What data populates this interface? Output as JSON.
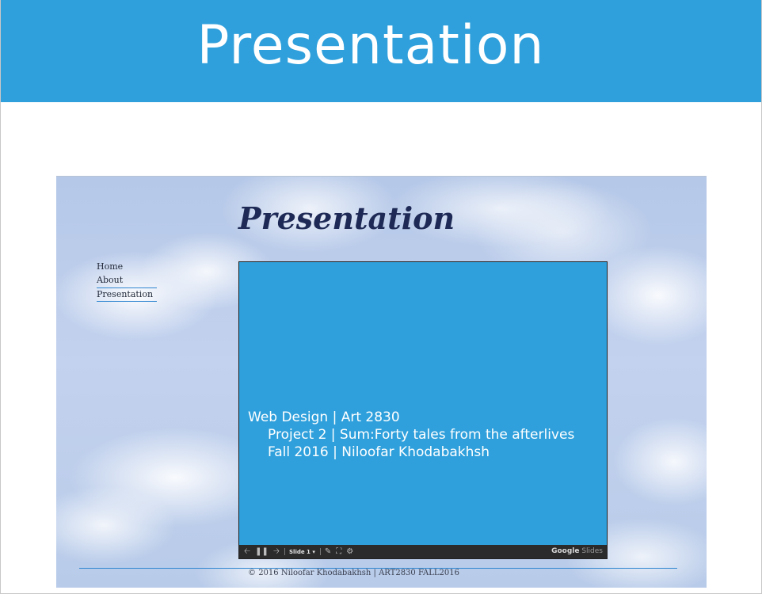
{
  "header": {
    "title": "Presentation"
  },
  "site": {
    "heading": "Presentation",
    "nav": [
      {
        "label": "Home"
      },
      {
        "label": "About"
      },
      {
        "label": "Presentation"
      }
    ],
    "active_nav": "Presentation",
    "slide": {
      "line1": "Web Design | Art 2830",
      "line2": "Project 2 | Sum:Forty tales from the afterlives",
      "line3": "Fall 2016 | Niloofar Khodabakhsh"
    },
    "toolbar": {
      "slide_label": "Slide 1 ▾",
      "brand_google": "Google",
      "brand_slides": "Slides"
    },
    "footer": "© 2016 Niloofar Khodabakhsh | ART2830 FALL2016"
  },
  "colors": {
    "header": "#2fa0dc",
    "slide_bg": "#2fa0dc",
    "heading": "#1e2a55"
  }
}
